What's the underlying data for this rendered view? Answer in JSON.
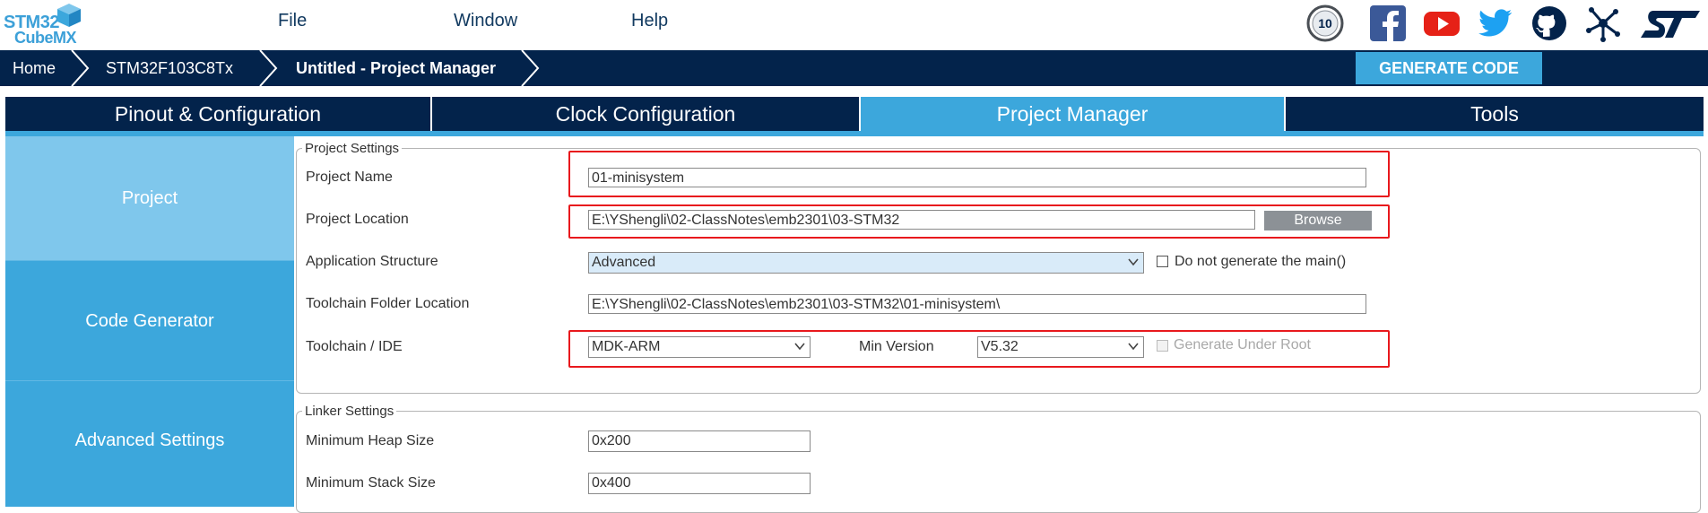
{
  "app": {
    "logo_line1": "STM32",
    "logo_line2": "CubeMX"
  },
  "menu": {
    "items": [
      "File",
      "Window",
      "Help"
    ]
  },
  "top_icons": [
    "anniversary-badge",
    "facebook",
    "youtube",
    "twitter",
    "github",
    "network",
    "st-logo"
  ],
  "top_icon_colors": {
    "facebook": "#3b5998",
    "youtube": "#e62117",
    "twitter": "#1da1f2",
    "github": "#03234b",
    "network": "#03234b",
    "st": "#03234b"
  },
  "badge_text": "10",
  "breadcrumb": [
    "Home",
    "STM32F103C8Tx",
    "Untitled - Project Manager"
  ],
  "generate_button": "GENERATE CODE",
  "tabs": [
    {
      "label": "Pinout & Configuration",
      "selected": false
    },
    {
      "label": "Clock Configuration",
      "selected": false
    },
    {
      "label": "Project Manager",
      "selected": true
    },
    {
      "label": "Tools",
      "selected": false
    }
  ],
  "sidebar": [
    "Project",
    "Code Generator",
    "Advanced Settings"
  ],
  "project_settings": {
    "legend": "Project Settings",
    "project_name_label": "Project Name",
    "project_name_value": "01-minisystem",
    "project_location_label": "Project Location",
    "project_location_value": "E:\\YShengli\\02-ClassNotes\\emb2301\\03-STM32",
    "browse_label": "Browse",
    "app_structure_label": "Application Structure",
    "app_structure_value": "Advanced",
    "no_main_label": "Do not generate the main()",
    "no_main_checked": false,
    "toolchain_folder_label": "Toolchain Folder Location",
    "toolchain_folder_value": "E:\\YShengli\\02-ClassNotes\\emb2301\\03-STM32\\01-minisystem\\",
    "toolchain_label": "Toolchain / IDE",
    "toolchain_value": "MDK-ARM",
    "min_version_label": "Min Version",
    "min_version_value": "V5.32",
    "gen_under_root_label": "Generate Under Root",
    "gen_under_root_checked": false
  },
  "linker_settings": {
    "legend": "Linker Settings",
    "heap_label": "Minimum Heap Size",
    "heap_value": "0x200",
    "stack_label": "Minimum Stack Size",
    "stack_value": "0x400"
  },
  "colors": {
    "navy": "#03234b",
    "accent_blue": "#3ca7dc",
    "sidebar_selected": "#7fc7ec",
    "highlight_red": "#e8191d"
  }
}
